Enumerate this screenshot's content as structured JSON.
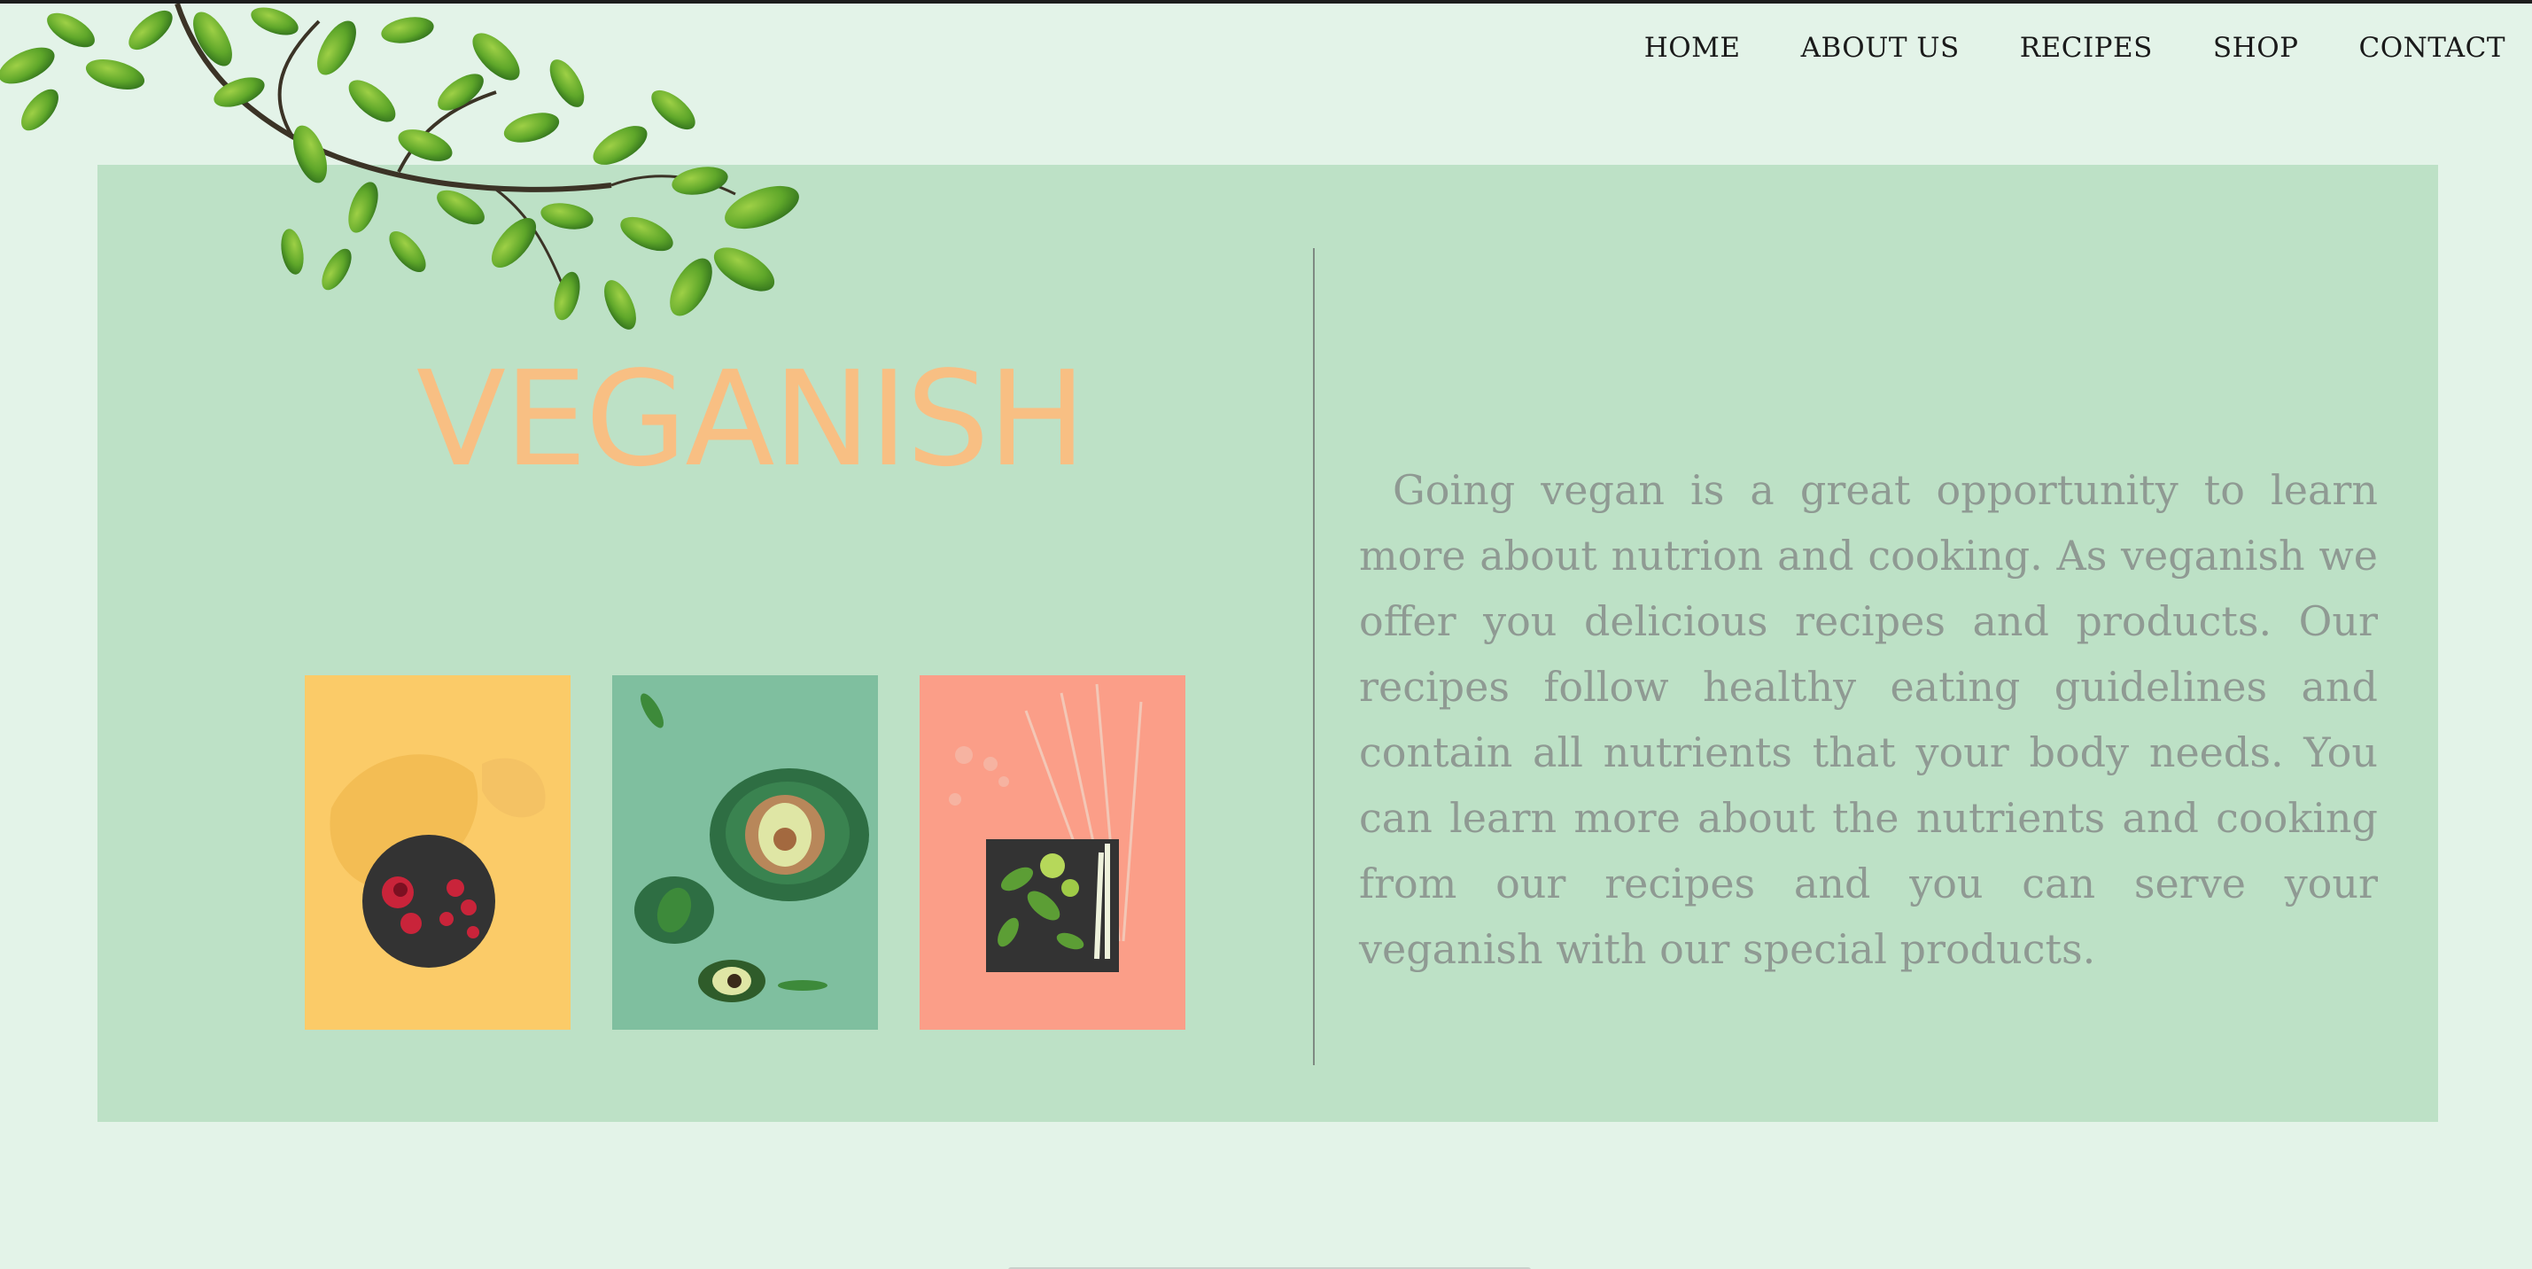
{
  "nav": {
    "items": [
      {
        "label": "HOME"
      },
      {
        "label": "ABOUT US"
      },
      {
        "label": "RECIPES"
      },
      {
        "label": "SHOP"
      },
      {
        "label": "CONTACT"
      }
    ]
  },
  "hero": {
    "brand": "VEGANISH",
    "description": "Going vegan is a great opportunity to learn more about nutrion and cooking. As veganish we offer you delicious recipes and products. Our recipes follow healthy eating guidelines and contain all nutrients that your body needs. You can learn more about the nutrients and cooking from our recipes and you can serve your veganish with our special products."
  },
  "colors": {
    "background": "#e3f3e8",
    "panel": "#bde1c6",
    "brand": "#f8bf83",
    "body_text": "#8f9a93",
    "tile_yellow": "#fbcb68",
    "tile_green": "#7fbf9f",
    "tile_salmon": "#fb9e88"
  },
  "icons": {
    "decoration": "leafy-branch-icon",
    "tiles": [
      "fruit-plate-photo",
      "avocado-bowl-photo",
      "greens-board-photo"
    ]
  }
}
